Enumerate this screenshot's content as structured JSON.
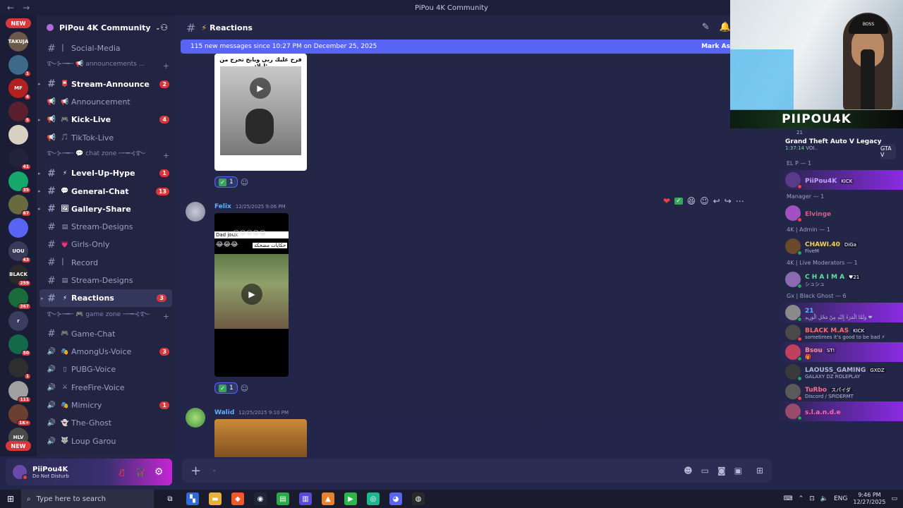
{
  "window": {
    "title": "PiPou 4K Community"
  },
  "server": {
    "name": "PiPou 4K Community"
  },
  "guilds": [
    {
      "badge": "",
      "color": "#6b5a4a",
      "label": "TAKUJA"
    },
    {
      "badge": "1",
      "color": "#3e6a8a",
      "label": ""
    },
    {
      "badge": "4",
      "color": "#b32020",
      "label": "MF"
    },
    {
      "badge": "5",
      "color": "#5a1f2e",
      "label": ""
    },
    {
      "badge": "",
      "color": "#d8d0c0",
      "label": ""
    },
    {
      "badge": "41",
      "color": "#22223a",
      "label": ""
    },
    {
      "badge": "35",
      "color": "#14a86b",
      "label": ""
    },
    {
      "badge": "67",
      "color": "#6a6a40",
      "label": ""
    },
    {
      "badge": "",
      "color": "#5865f2",
      "label": ""
    },
    {
      "badge": "43",
      "color": "#3a3a5a",
      "label": "UOU"
    },
    {
      "badge": "259",
      "color": "#2a2a2a",
      "label": "BLACK"
    },
    {
      "badge": "367",
      "color": "#1b6a3a",
      "label": ""
    },
    {
      "badge": "",
      "color": "#3a3d5e",
      "label": "r"
    },
    {
      "badge": "50",
      "color": "#126a4a",
      "label": ""
    },
    {
      "badge": "1",
      "color": "#2e2e2e",
      "label": ""
    },
    {
      "badge": "111",
      "color": "#a0a0a0",
      "label": ""
    },
    {
      "badge": "1K+",
      "color": "#6a4030",
      "label": ""
    },
    {
      "badge": "",
      "color": "#4a4a4a",
      "label": "HLV"
    }
  ],
  "guild_new_top": "NEW",
  "guild_new_bottom": "NEW",
  "channels": [
    {
      "type": "cat",
      "name": "",
      "emoji": "",
      "label": "Social-Media",
      "kind": "text",
      "bold": false,
      "badge": "",
      "arrow": false
    },
    {
      "type": "category",
      "label": "࿐⊱┉━─ 📢 announcements ... "
    },
    {
      "type": "ch",
      "kind": "text",
      "emoji": "📮",
      "label": "Stream-Announce",
      "bold": true,
      "badge": "2",
      "arrow": true
    },
    {
      "type": "ch",
      "kind": "announce",
      "emoji": "📢",
      "label": "Announcement",
      "bold": false,
      "badge": "",
      "arrow": false
    },
    {
      "type": "ch",
      "kind": "announce",
      "emoji": "🎮",
      "label": "Kick-Live",
      "bold": true,
      "badge": "4",
      "arrow": true
    },
    {
      "type": "ch",
      "kind": "announce",
      "emoji": "🎵",
      "label": "TikTok-Live",
      "bold": false,
      "badge": "",
      "arrow": false
    },
    {
      "type": "category",
      "label": "࿐⊱┉━─ 💬 chat zone ─┉━⊰࿐"
    },
    {
      "type": "ch",
      "kind": "text",
      "emoji": "⚡",
      "label": "Level-Up-Hype",
      "bold": true,
      "badge": "1",
      "arrow": true
    },
    {
      "type": "ch",
      "kind": "text",
      "emoji": "💬",
      "label": "General-Chat",
      "bold": true,
      "badge": "13",
      "arrow": true
    },
    {
      "type": "ch",
      "kind": "text",
      "emoji": "🖼",
      "label": "Gallery-Share",
      "bold": true,
      "badge": "",
      "arrow": true
    },
    {
      "type": "ch",
      "kind": "text",
      "emoji": "▤",
      "label": "Stream-Designs",
      "bold": false,
      "badge": "",
      "arrow": false
    },
    {
      "type": "ch",
      "kind": "text",
      "emoji": "💗",
      "label": "Girls-Only",
      "bold": false,
      "badge": "",
      "arrow": false
    },
    {
      "type": "ch",
      "kind": "text",
      "emoji": "",
      "label": "Record",
      "bold": false,
      "badge": "",
      "arrow": false
    },
    {
      "type": "ch",
      "kind": "text",
      "emoji": "▤",
      "label": "Stream-Designs",
      "bold": false,
      "badge": "",
      "arrow": false
    },
    {
      "type": "ch",
      "kind": "text",
      "emoji": "⚡",
      "label": "Reactions",
      "bold": true,
      "badge": "3",
      "arrow": true,
      "active": true
    },
    {
      "type": "category",
      "label": "࿐⊱┉━─ 🎮 game zone ─┉━⊰࿐"
    },
    {
      "type": "ch",
      "kind": "text",
      "emoji": "🎮",
      "label": "Game-Chat",
      "bold": false,
      "badge": "",
      "arrow": false
    },
    {
      "type": "ch",
      "kind": "voice",
      "emoji": "🎭",
      "label": "AmongUs-Voice",
      "bold": false,
      "badge": "3",
      "arrow": false
    },
    {
      "type": "ch",
      "kind": "voice",
      "emoji": "▯",
      "label": "PUBG-Voice",
      "bold": false,
      "badge": "",
      "arrow": false
    },
    {
      "type": "ch",
      "kind": "voice",
      "emoji": "⚔",
      "label": "FreeFire-Voice",
      "bold": false,
      "badge": "",
      "arrow": false
    },
    {
      "type": "ch",
      "kind": "voice",
      "emoji": "🎭",
      "label": "Mimicry",
      "bold": false,
      "badge": "1",
      "arrow": false
    },
    {
      "type": "ch",
      "kind": "voice",
      "emoji": "👻",
      "label": "The-Ghost",
      "bold": false,
      "badge": "",
      "arrow": false
    },
    {
      "type": "ch",
      "kind": "voice",
      "emoji": "🐺",
      "label": "Loup Garou",
      "bold": false,
      "badge": "",
      "arrow": false
    }
  ],
  "user": {
    "name": "PiiPou4K",
    "status": "Do Not Disturb"
  },
  "chat": {
    "channel": "Reactions",
    "new_messages": "115 new messages since 10:27 PM on December 25, 2025",
    "mark_as": "Mark As"
  },
  "messages": [
    {
      "caption": "فرح عليك ربي ويابخ تخرج من ليلاد:",
      "reaction_count": "1"
    },
    {
      "author": "Felix",
      "author_color": "#5fb0ff",
      "timestamp": "12/25/2025 9:06 PM",
      "caption_top": "Dad joux",
      "caption_ar": "حكايات مضحكة",
      "reaction_count": "1"
    },
    {
      "author": "Walid",
      "author_color": "#5fb0ff",
      "timestamp": "12/25/2025 9:10 PM"
    }
  ],
  "composer": {
    "placeholder": "-"
  },
  "members": {
    "game": {
      "title": "Grand Theft Auto V Legacy",
      "time": "1:37:14",
      "extra": "VOI..",
      "icon_label": "GTA V",
      "user": "21"
    },
    "groups": [
      {
        "title": "EL P — 1",
        "members": [
          {
            "name": "PiiPou4K",
            "color": "#c8a0ff",
            "tag": "KICK",
            "sub": "",
            "status": "#f23f43",
            "av": "#5a3a8a",
            "hl": true
          }
        ]
      },
      {
        "title": "Manager — 1",
        "members": [
          {
            "name": "Elvinge",
            "color": "#d85a8a",
            "tag": "",
            "sub": "",
            "status": "#f23f43",
            "av": "#a050c0",
            "hl": false
          }
        ]
      },
      {
        "title": "4K | Admin — 1",
        "members": [
          {
            "name": "CHAWI.40",
            "color": "#f5d442",
            "tag": "DiGa",
            "sub": "FiveM",
            "status": "#23a55a",
            "av": "#6a4a2a",
            "hl": false
          }
        ]
      },
      {
        "title": "4K | Live Moderators — 1",
        "members": [
          {
            "name": "C H A I M A",
            "color": "#5ee0a0",
            "tag": "♥21",
            "sub": "シュシュ",
            "status": "#23a55a",
            "av": "#8a6ab0",
            "hl": false
          }
        ]
      },
      {
        "title": "Gx | Black Ghost — 6",
        "members": [
          {
            "name": "21",
            "color": "#5fb0ff",
            "tag": "",
            "sub": "وَلَمَّا الْمَرَءُ إِلَيْهِ مِنْ مَحْلِ الْوَرِيدِ ❤",
            "status": "#23a55a",
            "av": "#8a8a8a",
            "hl": true
          },
          {
            "name": "BLACK M.AS",
            "color": "#ff6a6a",
            "tag": "KICK",
            "sub": "sometimes it's good to be bad ⚡",
            "status": "#f23f43",
            "av": "#4a4a4a",
            "hl": false
          },
          {
            "name": "Bsou",
            "color": "#ff8a8a",
            "tag": "ST!",
            "sub": "🎁",
            "status": "#23a55a",
            "av": "#c04060",
            "hl": true
          },
          {
            "name": "LAOUSS_GAMING",
            "color": "#b5b8d5",
            "tag": "GXDZ",
            "sub": "GALAXY DZ ROLEPLAY",
            "status": "#23a55a",
            "av": "#3a3a3a",
            "hl": false
          },
          {
            "name": "TuRbo",
            "color": "#ff6a8a",
            "tag": "スパイダ",
            "sub": "Discord / SPIDERMT",
            "status": "#f23f43",
            "av": "#5a5a5a",
            "hl": false
          },
          {
            "name": "s.l.a.n.d.e",
            "color": "#ff6aa0",
            "tag": "",
            "sub": "",
            "status": "#23a55a",
            "av": "#9a4a6a",
            "hl": true
          }
        ]
      }
    ]
  },
  "webcam": {
    "banner": "PIIPOU4K",
    "cap": "BOSS"
  },
  "taskbar": {
    "search_placeholder": "Type here to search",
    "lang": "ENG",
    "time": "9:46 PM",
    "date": "12/27/2025"
  }
}
